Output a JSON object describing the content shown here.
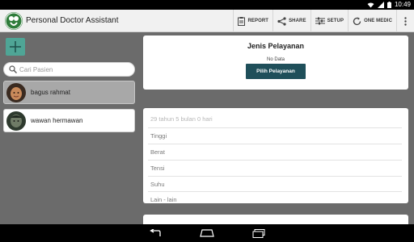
{
  "status_bar": {
    "time": "10:49"
  },
  "app": {
    "title": "Personal Doctor Assistant"
  },
  "actions": [
    {
      "label": "REPORT",
      "icon": "report-icon"
    },
    {
      "label": "SHARE",
      "icon": "share-icon"
    },
    {
      "label": "SETUP",
      "icon": "setup-icon"
    },
    {
      "label": "ONE MEDIC",
      "icon": "sync-icon"
    }
  ],
  "search": {
    "placeholder": "Cari Pasien",
    "value": ""
  },
  "patients": [
    {
      "name": "bagus rahmat",
      "selected": true
    },
    {
      "name": "wawan  hermawan",
      "selected": false
    }
  ],
  "service": {
    "title": "Jenis Pelayanan",
    "status": "No Data",
    "button": "Pilih Pelayanan"
  },
  "vitals": {
    "age": "29 tahun 5 bulan 0 hari",
    "fields": [
      "Tinggi",
      "Berat",
      "Tensi",
      "Suhu",
      "Lain - lain"
    ]
  },
  "colors": {
    "accent": "#4fa596",
    "button": "#1f4f5a",
    "background": "#6b6b6b"
  }
}
